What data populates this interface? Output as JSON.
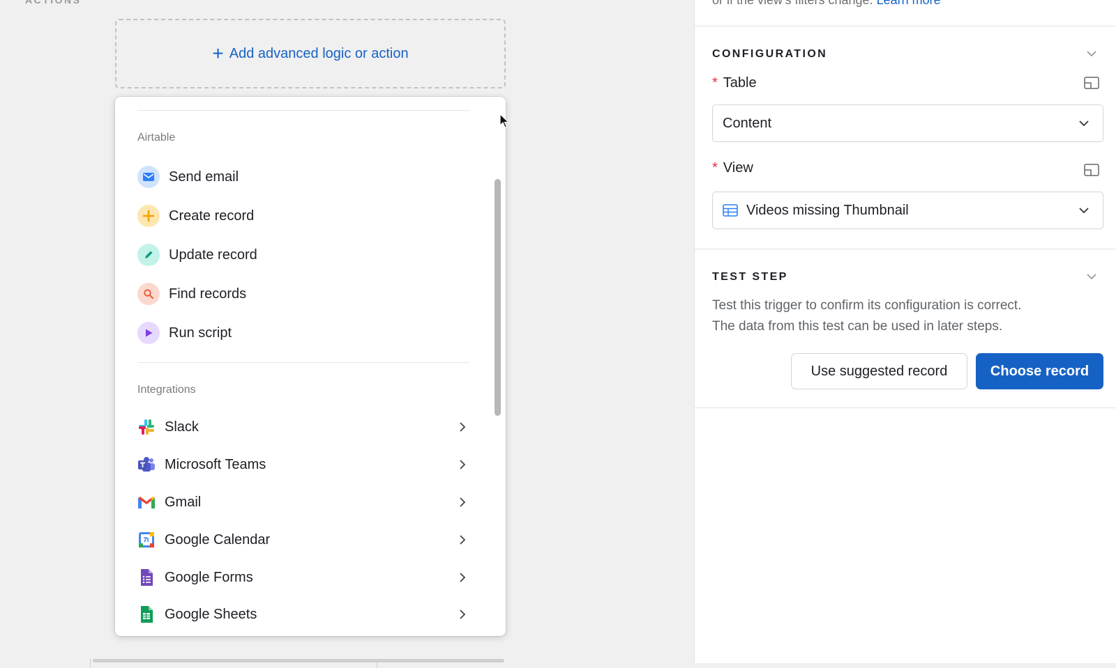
{
  "canvas": {
    "actions_label": "ACTIONS",
    "add_action_label": "Add advanced logic or action"
  },
  "menu": {
    "airtable_section": "Airtable",
    "airtable_items": [
      {
        "label": "Send email",
        "icon": "mail-icon",
        "color": "#2d7ff9"
      },
      {
        "label": "Create record",
        "icon": "plus-icon",
        "color": "#fcb400"
      },
      {
        "label": "Update record",
        "icon": "pencil-icon",
        "color": "#11a48a"
      },
      {
        "label": "Find records",
        "icon": "search-icon",
        "color": "#e8603c"
      },
      {
        "label": "Run script",
        "icon": "play-icon",
        "color": "#8b46ff"
      }
    ],
    "integrations_section": "Integrations",
    "integration_items": [
      {
        "label": "Slack",
        "icon": "slack-icon"
      },
      {
        "label": "Microsoft Teams",
        "icon": "microsoft-teams-icon"
      },
      {
        "label": "Gmail",
        "icon": "gmail-icon"
      },
      {
        "label": "Google Calendar",
        "icon": "google-calendar-icon"
      },
      {
        "label": "Google Forms",
        "icon": "google-forms-icon"
      },
      {
        "label": "Google Sheets",
        "icon": "google-sheets-icon"
      }
    ]
  },
  "panel": {
    "partial_text": "or if the view's filters change.",
    "learn_more": "Learn more",
    "configuration_title": "CONFIGURATION",
    "table_label": "Table",
    "table_value": "Content",
    "view_label": "View",
    "view_value": "Videos missing Thumbnail",
    "required_marker": "*",
    "test_step_title": "TEST STEP",
    "test_desc_line1": "Test this trigger to confirm its configuration is correct.",
    "test_desc_line2": "The data from this test can be used in later steps.",
    "use_suggested_label": "Use suggested record",
    "choose_record_label": "Choose record"
  },
  "colors": {
    "accent": "#1662c4",
    "required": "#e0303f"
  }
}
